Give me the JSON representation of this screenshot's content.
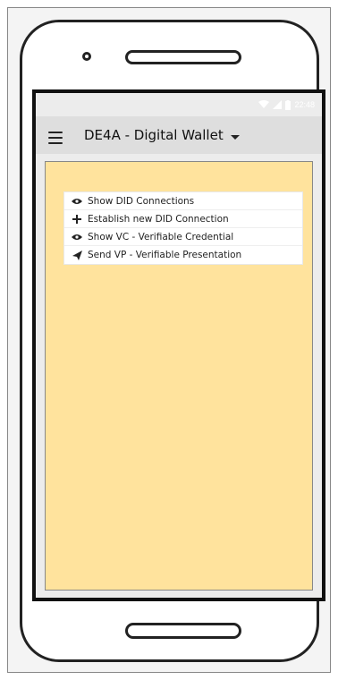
{
  "status_bar": {
    "time": "22:48",
    "icons": [
      "wifi-icon",
      "signal-icon",
      "battery-icon"
    ]
  },
  "app_bar": {
    "title": "DE4A - Digital Wallet",
    "menu_icon": "hamburger-menu-icon",
    "dropdown_icon": "chevron-down-icon"
  },
  "content": {
    "background_color": "#ffe39d",
    "menu_items": [
      {
        "label": "Show DID Connections",
        "icon": "eye-icon"
      },
      {
        "label": "Establish new DID Connection",
        "icon": "plus-icon"
      },
      {
        "label": "Show VC - Verifiable Credential",
        "icon": "eye-icon"
      },
      {
        "label": "Send VP - Verifiable Presentation",
        "icon": "send-icon"
      }
    ]
  }
}
